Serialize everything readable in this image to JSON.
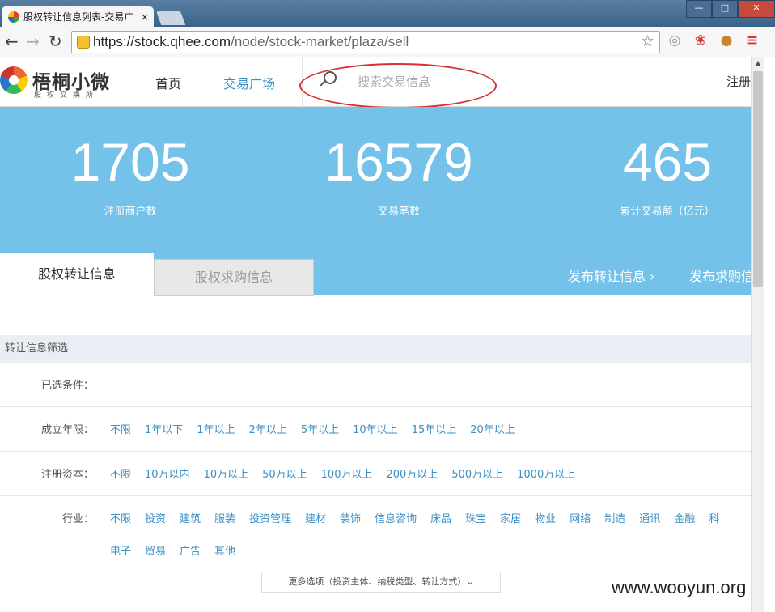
{
  "browser": {
    "tab_title": "股权转让信息列表-交易广",
    "tab_close": "×",
    "url_prefix": "https://",
    "url_host": "stock.qhee.com",
    "url_path": "/node/stock-market/plaza/sell",
    "window_buttons": [
      "—",
      "□",
      "✕"
    ]
  },
  "header": {
    "logo_name": "梧桐小微",
    "logo_sub": "股权交换所",
    "nav": [
      "首页",
      "交易广场"
    ],
    "search_placeholder": "搜索交易信息",
    "register": "注册"
  },
  "stats": [
    {
      "value": "1705",
      "label": "注册商户数"
    },
    {
      "value": "16579",
      "label": "交易笔数"
    },
    {
      "value": "465",
      "label": "累计交易额（亿元）"
    }
  ],
  "tabs": {
    "active": "股权转让信息",
    "inactive": "股权求购信息",
    "publish_sell": "发布转让信息 ›",
    "publish_buy": "发布求购信"
  },
  "filter": {
    "title": "转让信息筛选",
    "selected_label": "已选条件：",
    "rows": [
      {
        "label": "成立年限：",
        "options": [
          "不限",
          "1年以下",
          "1年以上",
          "2年以上",
          "5年以上",
          "10年以上",
          "15年以上",
          "20年以上"
        ]
      },
      {
        "label": "注册资本：",
        "options": [
          "不限",
          "10万以内",
          "10万以上",
          "50万以上",
          "100万以上",
          "200万以上",
          "500万以上",
          "1000万以上"
        ]
      },
      {
        "label": "行业：",
        "options": [
          "不限",
          "投资",
          "建筑",
          "服装",
          "投资管理",
          "建材",
          "装饰",
          "信息咨询",
          "床品",
          "珠宝",
          "家居",
          "物业",
          "网络",
          "制造",
          "通讯",
          "金融",
          "科"
        ],
        "options2": [
          "电子",
          "贸易",
          "广告",
          "其他"
        ]
      }
    ],
    "more_options": "更多选项（投资主体、纳税类型、转让方式）⌄"
  },
  "watermark": "www.wooyun.org"
}
